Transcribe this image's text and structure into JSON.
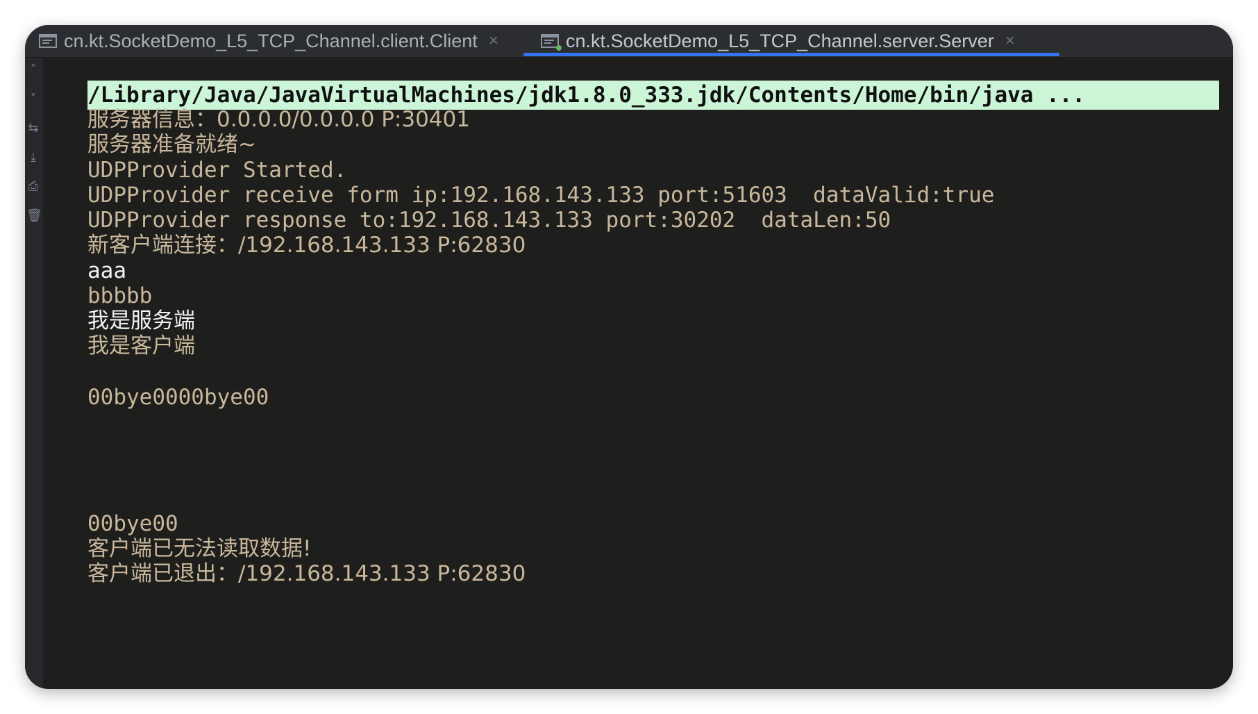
{
  "tabs": [
    {
      "label": "cn.kt.SocketDemo_L5_TCP_Channel.client.Client",
      "close": "×",
      "active": false
    },
    {
      "label": "cn.kt.SocketDemo_L5_TCP_Channel.server.Server",
      "close": "×",
      "active": true
    }
  ],
  "gutter_icons": [
    "rerun-icon",
    "scroll-down-icon",
    "print-icon",
    "trash-icon"
  ],
  "console": {
    "command": "/Library/Java/JavaVirtualMachines/jdk1.8.0_333.jdk/Contents/Home/bin/java ...",
    "lines": [
      "服务器信息：0.0.0.0/0.0.0.0 P:30401",
      "服务器准备就绪~",
      "UDPProvider Started.",
      "UDPProvider receive form ip:192.168.143.133 port:51603  dataValid:true",
      "UDPProvider response to:192.168.143.133 port:30202  dataLen:50",
      "新客户端连接：/192.168.143.133 P:62830",
      "aaa",
      "bbbbb",
      "我是服务端",
      "我是客户端",
      "",
      "00bye0000bye00",
      "",
      "",
      "",
      "",
      "00bye00",
      "客户端已无法读取数据!",
      "客户端已退出：/192.168.143.133 P:62830"
    ]
  },
  "colors": {
    "background": "#1e1f1c",
    "output_text": "#c9b79c",
    "input_text": "#f2f2f2",
    "command_highlight": "#ccf5d8",
    "active_tab_underline": "#3574f0"
  }
}
